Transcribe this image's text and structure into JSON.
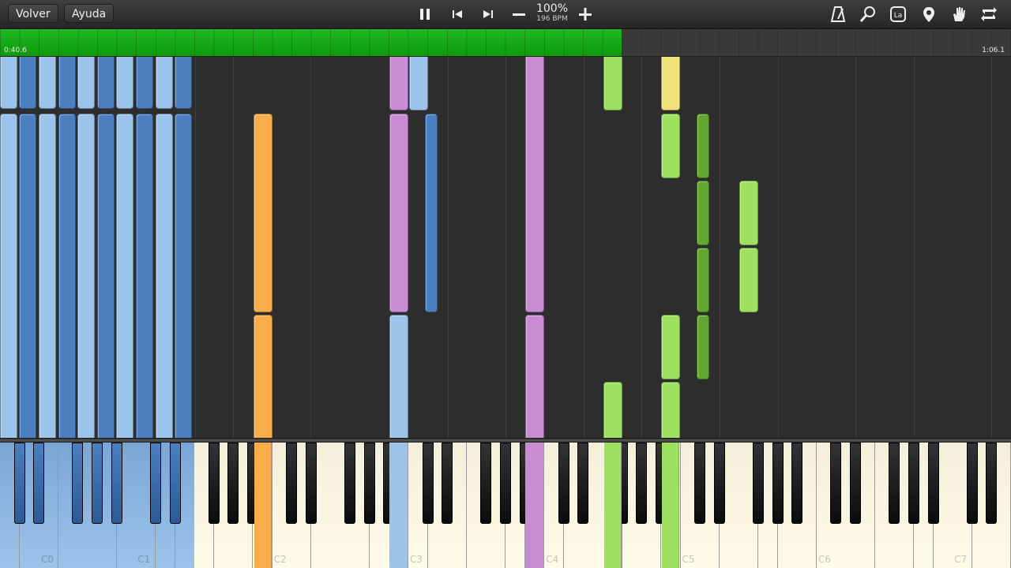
{
  "toolbar": {
    "back_label": "Volver",
    "help_label": "Ayuda",
    "zoom_label": "100%",
    "bpm_label": "196 BPM",
    "icons": [
      "pause-icon",
      "skip-back-icon",
      "skip-forward-icon",
      "minus-icon",
      "plus-icon",
      "metronome-icon",
      "magnifier-icon",
      "note-label-icon",
      "location-pin-icon",
      "hand-icon",
      "loop-icon"
    ],
    "note_label_icon_text": "La"
  },
  "progress": {
    "current_time": "0:40.6",
    "total_time": "1:06.1",
    "fraction": 0.615,
    "color": "#14a814"
  },
  "keyboard": {
    "octave_labels": [
      "C0",
      "C1",
      "C2",
      "C3",
      "C4",
      "C5",
      "C6",
      "C7"
    ],
    "hand_colors": {
      "left_light": "#9cc3ea",
      "left_dark": "#4b7fbf",
      "orange": "#f9ad4a",
      "pink": "#c98bd3",
      "green_light": "#9ee060",
      "green_dark": "#62a830",
      "yellow": "#f0e27a"
    }
  }
}
